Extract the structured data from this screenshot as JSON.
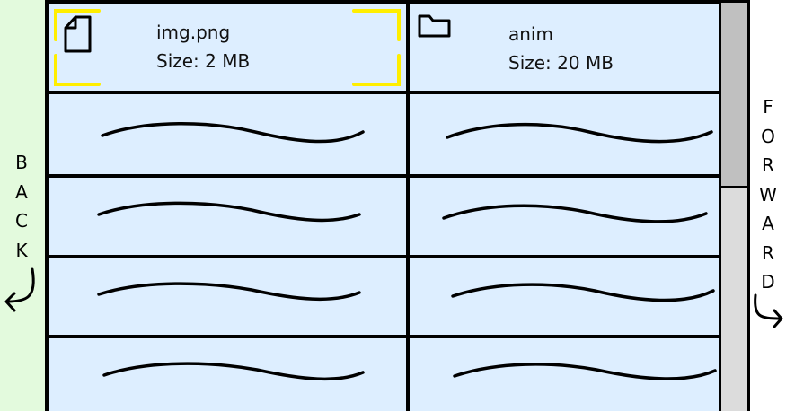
{
  "navigation": {
    "back_letters": [
      "B",
      "A",
      "C",
      "K"
    ],
    "forward_letters": [
      "F",
      "O",
      "R",
      "W",
      "A",
      "R",
      "D"
    ],
    "back_icon": "arrow-back-icon",
    "forward_icon": "arrow-forward-icon"
  },
  "files": [
    {
      "name": "img.png",
      "size": "Size: 2 MB",
      "icon": "file-icon",
      "selected": true
    },
    {
      "name": "anim",
      "size": "Size: 20 MB",
      "icon": "folder-icon",
      "selected": false
    }
  ],
  "colors": {
    "back_panel": "#e3fadd",
    "cell_background": "#ddeeff",
    "selection": "#ffee00",
    "scroll_thumb": "#c0c0c0",
    "scroll_track": "#dcdcdc"
  }
}
